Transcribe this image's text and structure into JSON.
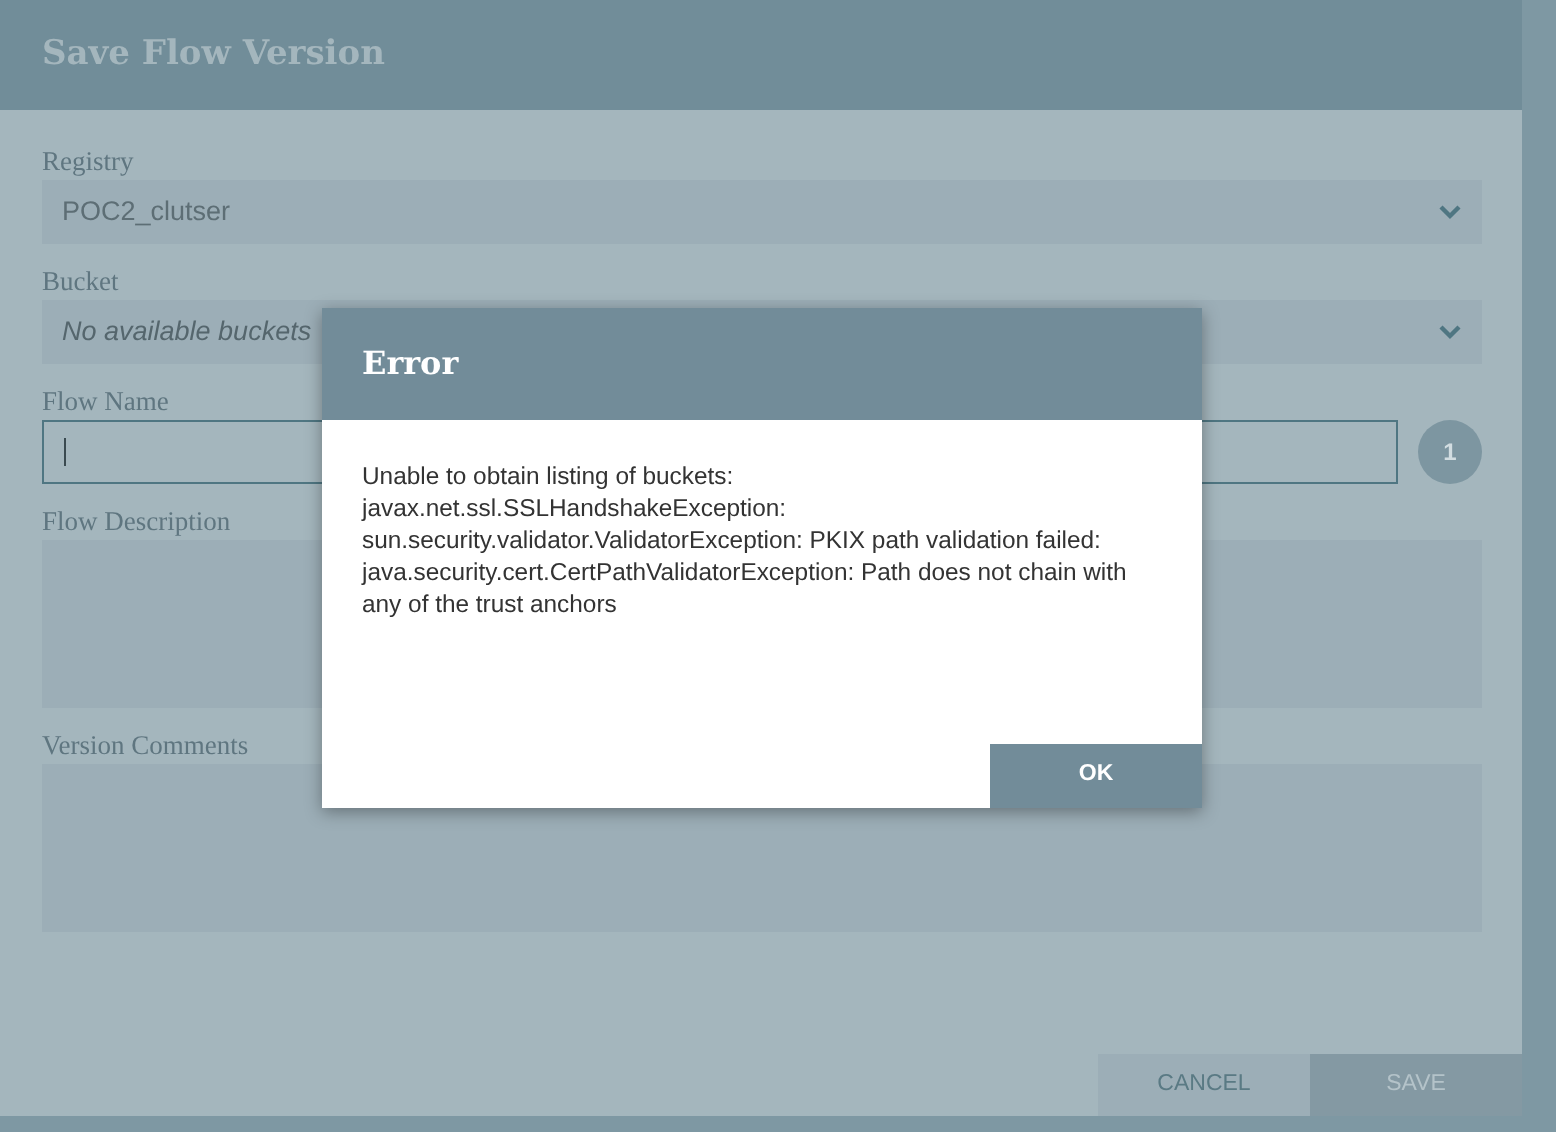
{
  "dialog": {
    "title": "Save Flow Version",
    "fields": [
      {
        "kind": "select",
        "label": "Registry",
        "value": "POC2_clutser"
      },
      {
        "kind": "select",
        "label": "Bucket",
        "placeholder": "No available buckets"
      },
      {
        "kind": "text",
        "label": "Flow Name",
        "focused": true,
        "counter": "1"
      },
      {
        "kind": "textarea",
        "label": "Flow Description"
      },
      {
        "kind": "textarea",
        "label": "Version Comments"
      }
    ],
    "buttons": [
      {
        "label": "CANCEL",
        "disabled": false
      },
      {
        "label": "SAVE",
        "disabled": true
      }
    ]
  },
  "error_dialog": {
    "title": "Error",
    "message": "Unable to obtain listing of buckets: javax.net.ssl.SSLHandshakeException: sun.security.validator.ValidatorException: PKIX path validation failed: java.security.cert.CertPathValidatorException: Path does not chain with any of the trust anchors",
    "button": "OK"
  }
}
